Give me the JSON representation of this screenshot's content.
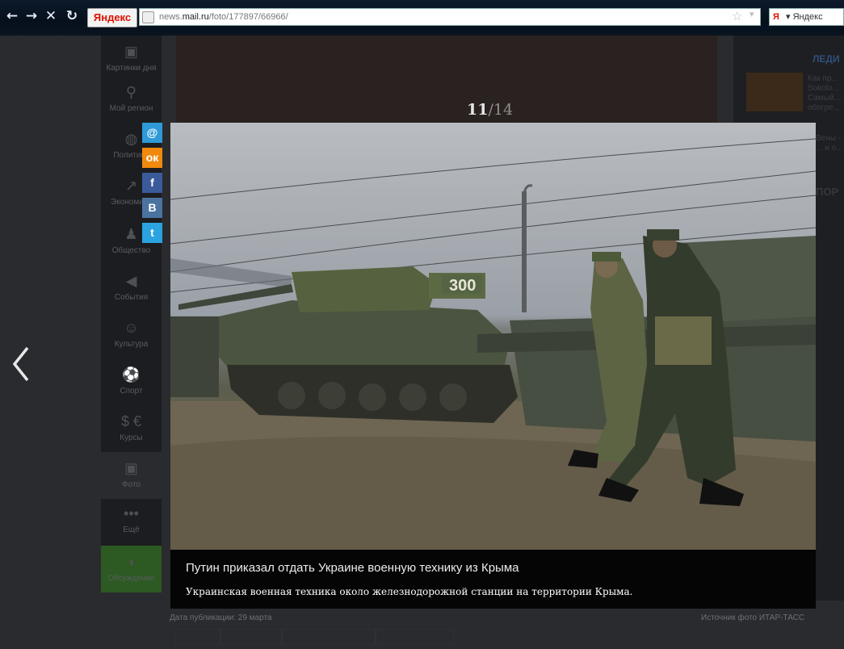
{
  "browser": {
    "back": "←",
    "forward": "→",
    "stop": "✕",
    "reload": "↻",
    "logo": "Яндекс",
    "url_domain_prefix": "news.",
    "url_domain": "mail.ru",
    "url_path": "/foto/177897/66966/",
    "search_logo": "Я",
    "search_text": "▾  Яндекс"
  },
  "leftnav": {
    "items": [
      {
        "label": "Картинки дня",
        "icon": "▣"
      },
      {
        "label": "Мой регион",
        "icon": "⚲"
      },
      {
        "label": "Политика",
        "icon": "◍"
      },
      {
        "label": "Экономика",
        "icon": "↗"
      },
      {
        "label": "Общество",
        "icon": "♟"
      },
      {
        "label": "События",
        "icon": "◀"
      },
      {
        "label": "Культура",
        "icon": "☺"
      },
      {
        "label": "Спорт",
        "icon": "⚽"
      },
      {
        "label": "Курсы",
        "icon": "$ €"
      },
      {
        "label": "Фото",
        "icon": "▣"
      },
      {
        "label": "Ещё",
        "icon": "•••"
      },
      {
        "label": "Обсуждение",
        "icon": "◖"
      }
    ]
  },
  "share": [
    {
      "name": "mail-ru-share-icon",
      "glyph": "@",
      "color": "#2e9ad8"
    },
    {
      "name": "odnoklassniki-share-icon",
      "glyph": "ок",
      "color": "#f0890d"
    },
    {
      "name": "facebook-share-icon",
      "glyph": "f",
      "color": "#3b5a9a"
    },
    {
      "name": "vkontakte-share-icon",
      "glyph": "В",
      "color": "#4b73a0"
    },
    {
      "name": "twitter-share-icon",
      "glyph": "t",
      "color": "#2aa3e0"
    }
  ],
  "viewer": {
    "current": "11",
    "total": "/14",
    "caption_title": "Путин приказал отдать Украине военную технику из Крыма",
    "caption_text": "Украинская военная техника около железнодорожной станции на территории Крыма.",
    "tank_number": "300"
  },
  "meta": {
    "date": "Дата публикации: 29 марта",
    "source": "Источник фото ИТАР-ТАСС"
  },
  "right_column": {
    "title": "ЛЕДИ",
    "item1": "Как пр... Sokolo... Самый... обогре...",
    "item2": "Вены - ... и о...",
    "section": "ПОР"
  },
  "colors": {
    "caption_bg": "#050505",
    "page_bg": "#2a2b2e"
  }
}
